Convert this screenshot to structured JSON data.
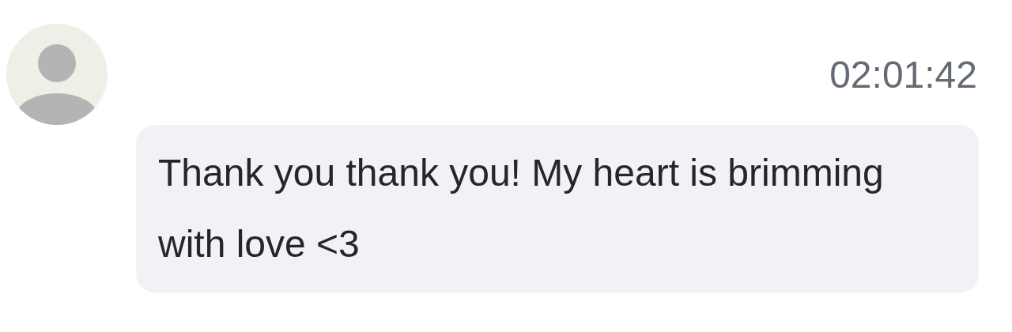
{
  "message": {
    "time": "02:01:42",
    "text": "Thank you thank you! My heart is brimming with love <3"
  }
}
